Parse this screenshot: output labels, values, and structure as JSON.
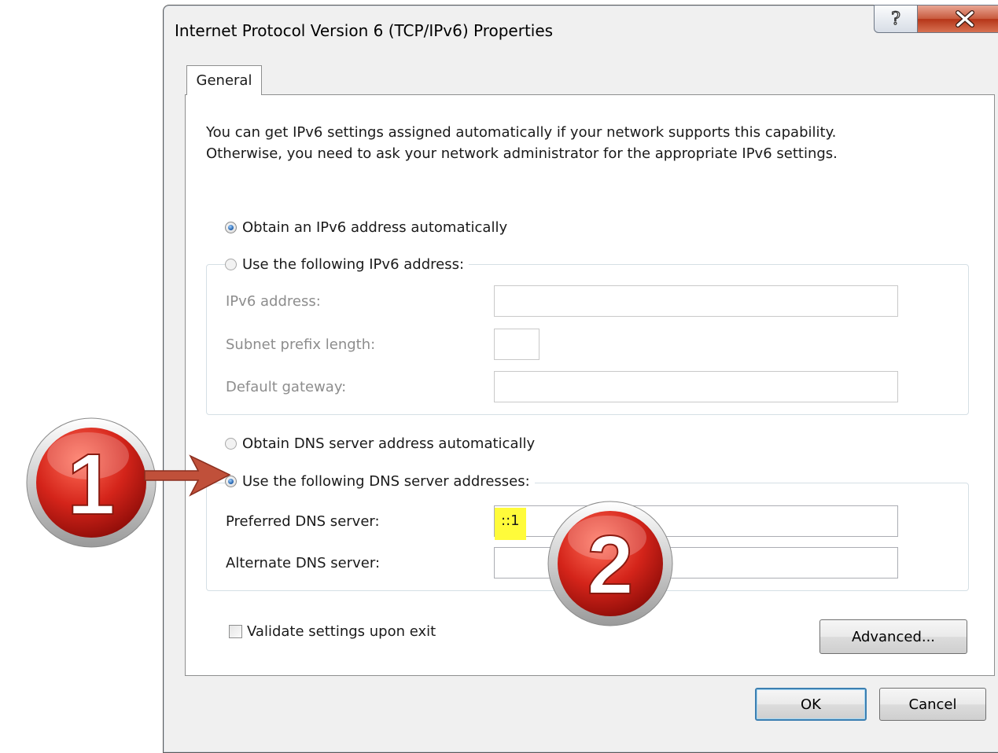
{
  "window": {
    "title": "Internet Protocol Version 6 (TCP/IPv6) Properties",
    "help_glyph": "?",
    "close_glyph": "X"
  },
  "tab": {
    "label": "General"
  },
  "intro": {
    "line1": "You can get IPv6 settings assigned automatically if your network supports this capability.",
    "line2": "Otherwise, you need to ask your network administrator for the appropriate IPv6 settings."
  },
  "address": {
    "auto_label": "Obtain an IPv6 address automatically",
    "manual_label": "Use the following IPv6 address:",
    "auto_selected": true,
    "fields": {
      "ipv6_label": "IPv6 address:",
      "ipv6_value": "",
      "prefix_label": "Subnet prefix length:",
      "prefix_value": "",
      "gateway_label": "Default gateway:",
      "gateway_value": ""
    }
  },
  "dns": {
    "auto_label": "Obtain DNS server address automatically",
    "manual_label": "Use the following DNS server addresses:",
    "manual_selected": true,
    "preferred_label": "Preferred DNS server:",
    "preferred_value": "::1",
    "alternate_label": "Alternate DNS server:",
    "alternate_value": ""
  },
  "validate": {
    "label": "Validate settings upon exit",
    "checked": false
  },
  "buttons": {
    "advanced": "Advanced...",
    "ok": "OK",
    "cancel": "Cancel"
  },
  "annotations": {
    "step1": "1",
    "step2": "2",
    "badge_color": "#c8201a",
    "arrow_color": "#c0503a",
    "highlight_color": "#fffb3a"
  }
}
